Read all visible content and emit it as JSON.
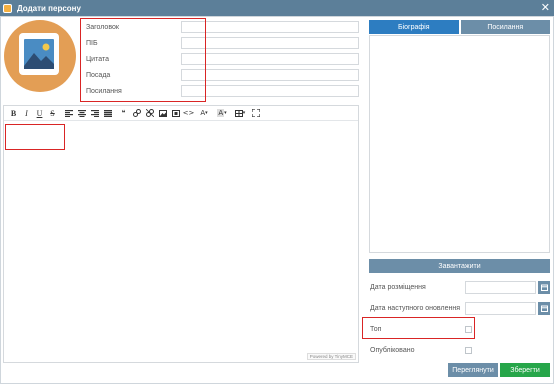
{
  "window": {
    "title": "Додати персону",
    "close_glyph": "✕"
  },
  "fields": [
    {
      "label": "Заголовок",
      "value": ""
    },
    {
      "label": "ПІБ",
      "value": ""
    },
    {
      "label": "Цитата",
      "value": ""
    },
    {
      "label": "Посада",
      "value": ""
    },
    {
      "label": "Посилання",
      "value": ""
    }
  ],
  "editor": {
    "toolbar": [
      "B",
      "I",
      "U",
      "S",
      "align-left",
      "align-center",
      "align-right",
      "justify",
      "quote",
      "link",
      "unlink",
      "image",
      "media",
      "code",
      "text-color",
      "background-color",
      "table",
      "fullscreen"
    ],
    "powered_by": "Powered by TinyMCE"
  },
  "tabs": [
    {
      "label": "Біографія",
      "active": true
    },
    {
      "label": "Посилання",
      "active": false
    }
  ],
  "upload_label": "Завантажити",
  "dates": [
    {
      "label": "Дата розміщення",
      "value": ""
    },
    {
      "label": "Дата наступного оновлення",
      "value": ""
    }
  ],
  "checks": [
    {
      "label": "Топ",
      "checked": false
    },
    {
      "label": "Опубліковано",
      "checked": false
    }
  ],
  "actions": {
    "preview": "Переглянути",
    "save": "Зберегти"
  },
  "colors": {
    "titlebar": "#5c7f99",
    "primary": "#2d7dc1",
    "secondary": "#6c8ea8",
    "success": "#27a64a",
    "avatar": "#e39e55",
    "highlight": "#d92525"
  }
}
